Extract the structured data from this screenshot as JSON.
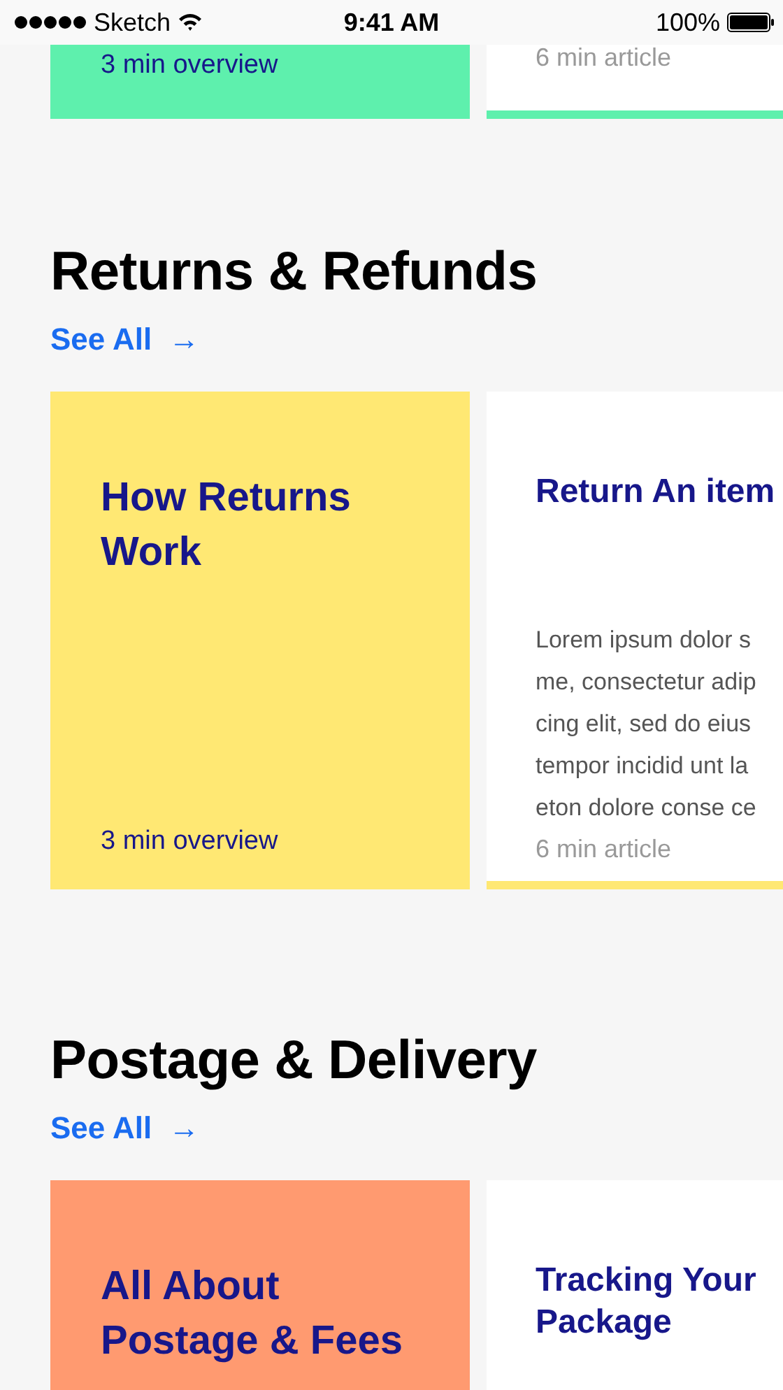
{
  "status_bar": {
    "carrier": "Sketch",
    "time": "9:41 AM",
    "battery": "100%"
  },
  "sections": [
    {
      "color": "#5ef0ad",
      "cards": [
        {
          "kind": "overview",
          "footer": "3 min overview"
        },
        {
          "kind": "article",
          "footer": "6 min article"
        }
      ]
    },
    {
      "heading": "Returns & Refunds",
      "see_all": "See All",
      "arrow": "→",
      "color": "#ffe873",
      "cards": [
        {
          "kind": "overview",
          "title": "How Returns Work",
          "footer": "3 min overview"
        },
        {
          "kind": "article",
          "title": "Return An item",
          "excerpt_lines": [
            "Lorem ipsum dolor s",
            "me, consectetur adip",
            "cing elit, sed do eius",
            "tempor incidid unt la",
            "eton dolore conse ce"
          ],
          "footer": "6 min article"
        }
      ]
    },
    {
      "heading": "Postage & Delivery",
      "see_all": "See All",
      "arrow": "→",
      "color": "#ff9a70",
      "cards": [
        {
          "kind": "overview",
          "title": "All About Postage & Fees"
        },
        {
          "kind": "article",
          "title": "Tracking Your Package"
        }
      ]
    }
  ]
}
